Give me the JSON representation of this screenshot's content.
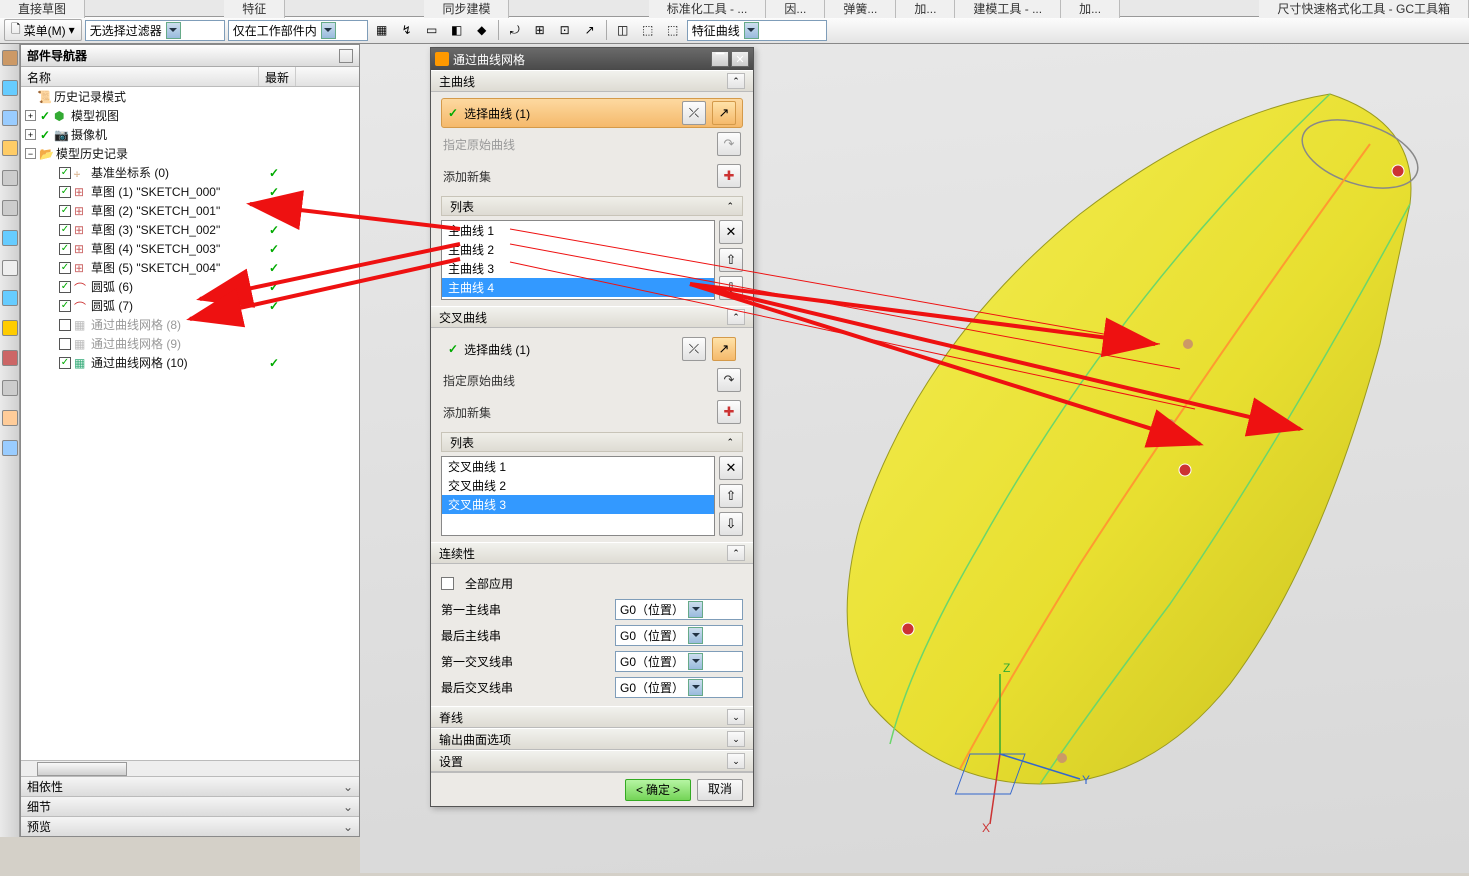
{
  "tabs": {
    "t1": "直接草图",
    "t2": "特征",
    "t3": "同步建模",
    "t4": "标准化工具 - ...",
    "t5": "因...",
    "t6": "弹簧...",
    "t7": "加...",
    "t8": "建模工具 - ...",
    "t9": "加...",
    "t10": "尺寸快速格式化工具 - GC工具箱"
  },
  "menu": {
    "label": "菜单(M)"
  },
  "filter": {
    "value": "无选择过滤器"
  },
  "scope": {
    "value": "仅在工作部件内"
  },
  "curvefilter": {
    "value": "特征曲线"
  },
  "partnav": {
    "title": "部件导航器",
    "col1": "名称",
    "col2": "最新",
    "n_history": "历史记录模式",
    "n_modelview": "模型视图",
    "n_camera": "摄像机",
    "n_modelhist": "模型历史记录",
    "n_datum": "基准坐标系 (0)",
    "n_sk1": "草图 (1) \"SKETCH_000\"",
    "n_sk2": "草图 (2) \"SKETCH_001\"",
    "n_sk3": "草图 (3) \"SKETCH_002\"",
    "n_sk4": "草图 (4) \"SKETCH_003\"",
    "n_sk5": "草图 (5) \"SKETCH_004\"",
    "n_arc6": "圆弧 (6)",
    "n_arc7": "圆弧 (7)",
    "n_mesh8": "通过曲线网格 (8)",
    "n_mesh9": "通过曲线网格 (9)",
    "n_mesh10": "通过曲线网格 (10)"
  },
  "footer": {
    "f1": "相依性",
    "f2": "细节",
    "f3": "预览"
  },
  "dialog": {
    "title": "通过曲线网格",
    "s_primary": "主曲线",
    "sel_curve": "选择曲线 (1)",
    "spec_origin": "指定原始曲线",
    "add_set": "添加新集",
    "list": "列表",
    "p1": "主曲线 1",
    "p2": "主曲线 2",
    "p3": "主曲线 3",
    "p4": "主曲线 4",
    "s_cross": "交叉曲线",
    "c1": "交叉曲线 1",
    "c2": "交叉曲线 2",
    "c3": "交叉曲线 3",
    "s_cont": "连续性",
    "apply_all": "全部应用",
    "first_p": "第一主线串",
    "last_p": "最后主线串",
    "first_c": "第一交叉线串",
    "last_c": "最后交叉线串",
    "g0": "G0（位置）",
    "s_spine": "脊线",
    "s_surf": "输出曲面选项",
    "s_set": "设置",
    "ok": "确定",
    "cancel": "取消"
  }
}
